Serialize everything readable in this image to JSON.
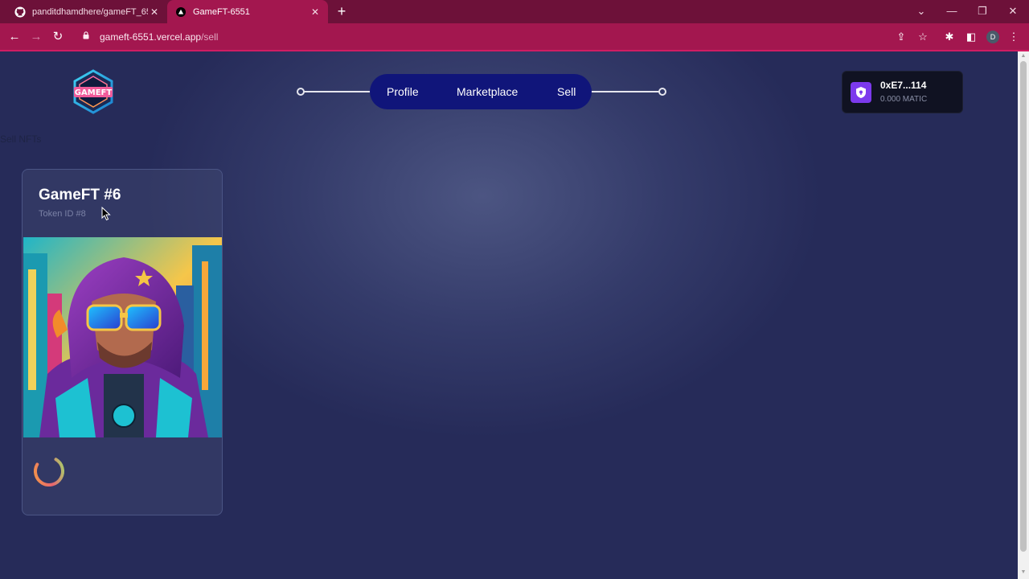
{
  "browser": {
    "tabs": [
      {
        "title": "panditdhamdhere/gameFT_6551",
        "icon": "github-icon",
        "active": false
      },
      {
        "title": "GameFT-6551",
        "icon": "vercel-icon",
        "active": true
      }
    ],
    "url_host": "gameft-6551.vercel.app",
    "url_path": "/sell",
    "profile_initial": "D"
  },
  "site": {
    "logo_text": "GAMEFT",
    "nav": {
      "profile_label": "Profile",
      "marketplace_label": "Marketplace",
      "sell_label": "Sell"
    },
    "wallet": {
      "address": "0xE7...114",
      "balance": "0.000 MATIC",
      "icon": "shield-icon"
    },
    "section_title": "Sell NFTs",
    "nft": {
      "name": "GameFT #6",
      "token_id": "Token ID #8",
      "image": "hooded-cyberpunk-character-art",
      "status": "loading"
    }
  },
  "colors": {
    "tab_bar": "#6d1139",
    "toolbar": "#a3174f",
    "nav_pill": "#10157a",
    "wallet_badge": "#7c3aed",
    "page_bg": "#2b3158"
  }
}
